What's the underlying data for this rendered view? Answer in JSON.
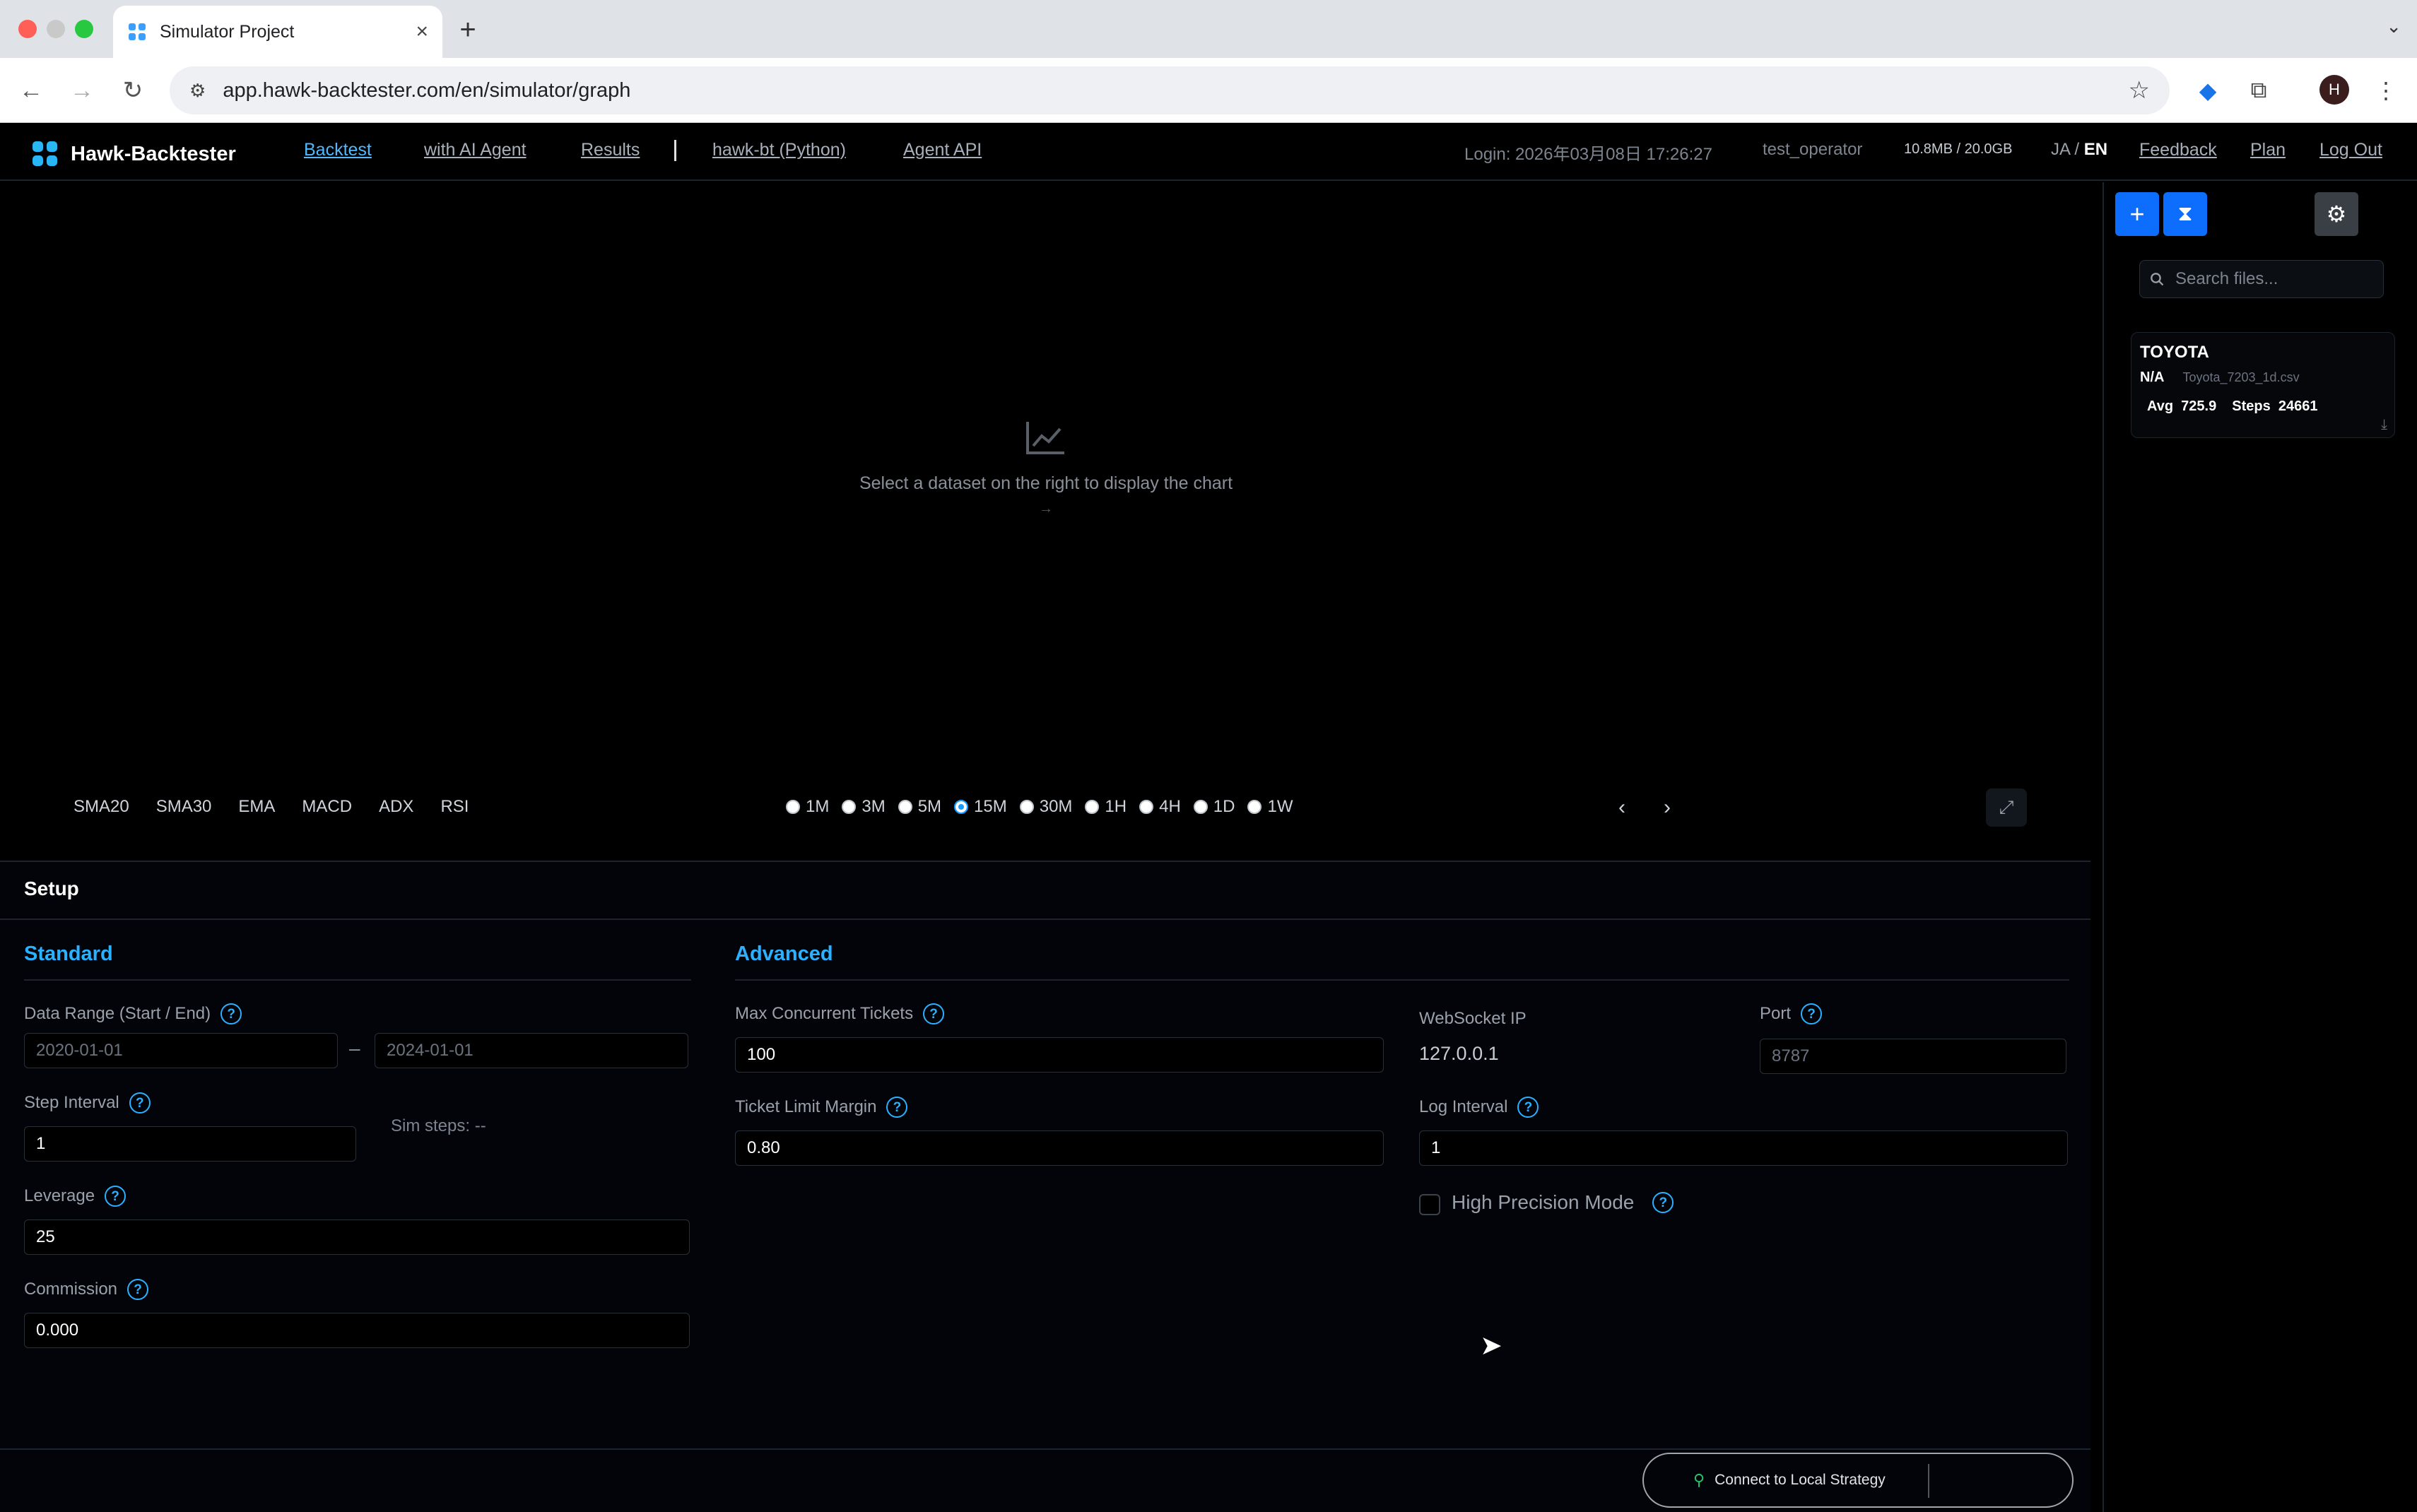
{
  "browser": {
    "tab_title": "Simulator Project",
    "tab_close": "×",
    "new_tab": "+",
    "url": "app.hawk-backtester.com/en/simulator/graph",
    "profile_initial": "H"
  },
  "header": {
    "brand": "Hawk-Backtester",
    "nav": [
      "Backtest",
      "with AI Agent",
      "Results",
      "hawk-bt (Python)",
      "Agent API"
    ],
    "login": "Login: 2026年03月08日 17:26:27",
    "user": "test_operator",
    "storage": "10.8MB / 20.0GB",
    "lang_ja": "JA",
    "lang_sep": "/",
    "lang_en": "EN",
    "feedback": "Feedback",
    "plan": "Plan",
    "logout": "Log Out"
  },
  "chart": {
    "empty_message": "Select a dataset on the right to display the chart",
    "empty_arrow": "→",
    "indicators": [
      "SMA20",
      "SMA30",
      "EMA",
      "MACD",
      "ADX",
      "RSI"
    ],
    "timeframes": [
      "1M",
      "3M",
      "5M",
      "15M",
      "30M",
      "1H",
      "4H",
      "1D",
      "1W"
    ],
    "selected_timeframe": "15M"
  },
  "sidebar": {
    "search_placeholder": "Search files...",
    "dataset": {
      "name": "TOYOTA",
      "status": "N/A",
      "file": "Toyota_7203_1d.csv",
      "avg_label": "Avg",
      "avg_value": "725.9",
      "steps_label": "Steps",
      "steps_value": "24661"
    }
  },
  "setup": {
    "title": "Setup",
    "standard": {
      "heading": "Standard",
      "data_range_label": "Data Range (Start / End)",
      "start_placeholder": "2020-01-01",
      "end_placeholder": "2024-01-01",
      "range_dash": "–",
      "step_interval_label": "Step Interval",
      "step_interval_value": "1",
      "sim_steps": "Sim steps: --",
      "leverage_label": "Leverage",
      "leverage_value": "25",
      "commission_label": "Commission",
      "commission_value": "0.000"
    },
    "advanced": {
      "heading": "Advanced",
      "max_tickets_label": "Max Concurrent Tickets",
      "max_tickets_value": "100",
      "ticket_margin_label": "Ticket Limit Margin",
      "ticket_margin_value": "0.80",
      "websocket_ip_label": "WebSocket IP",
      "websocket_ip_value": "127.0.0.1",
      "port_label": "Port",
      "port_placeholder": "8787",
      "log_interval_label": "Log Interval",
      "log_interval_value": "1",
      "high_precision_label": "High Precision Mode"
    }
  },
  "footer": {
    "connect_label": "Connect to Local Strategy"
  },
  "colors": {
    "accent": "#2ab1ff",
    "primary_button": "#0d6efd",
    "background": "#000000"
  }
}
